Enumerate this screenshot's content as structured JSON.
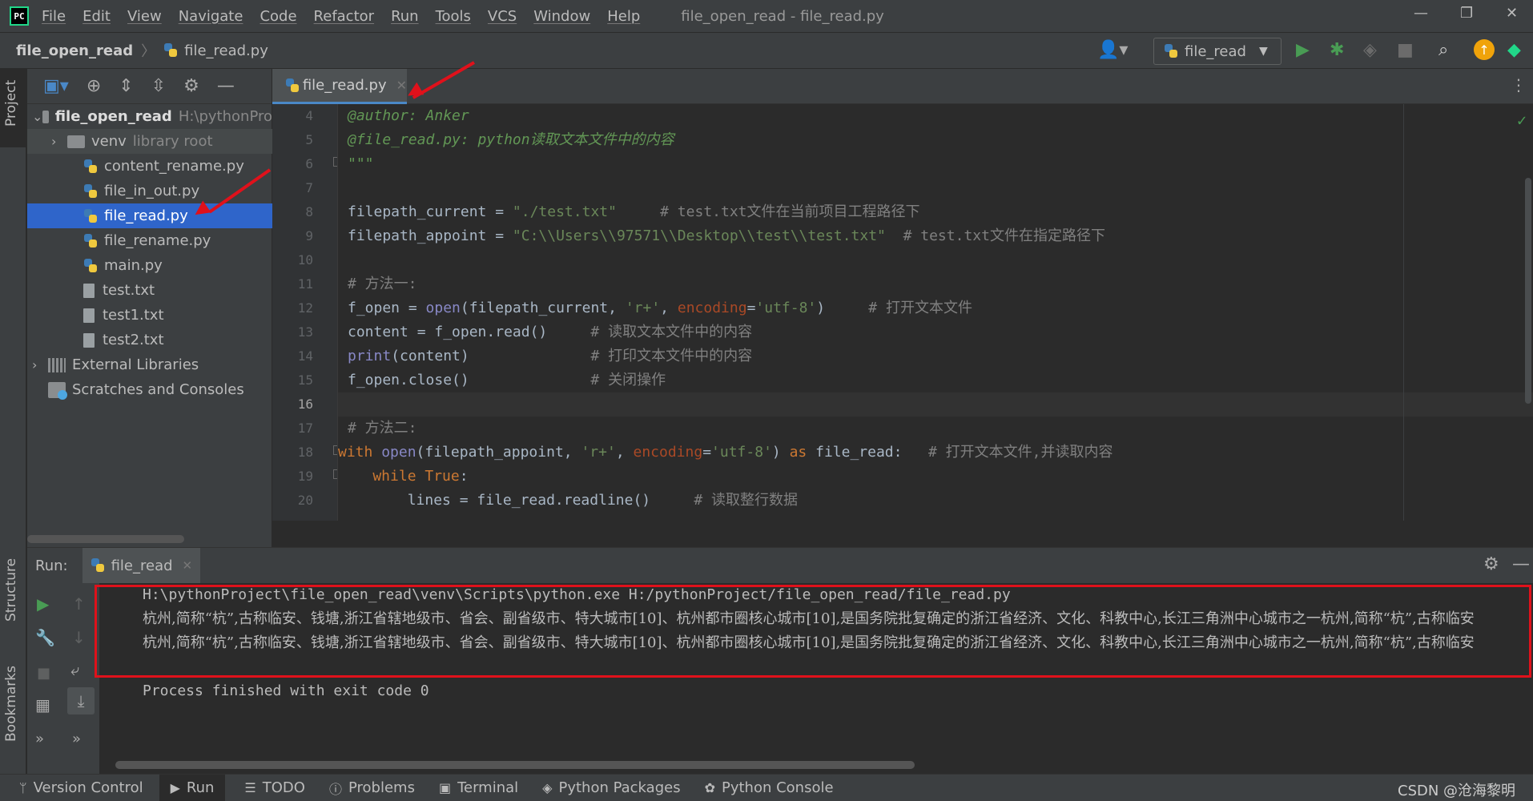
{
  "menubar": {
    "logo": "PC",
    "items": [
      "File",
      "Edit",
      "View",
      "Navigate",
      "Code",
      "Refactor",
      "Run",
      "Tools",
      "VCS",
      "Window",
      "Help"
    ],
    "title": "file_open_read - file_read.py",
    "controls": [
      "—",
      "❐",
      "✕"
    ]
  },
  "navbar": {
    "project": "file_open_read",
    "file": "file_read.py",
    "run_config": "file_read"
  },
  "sidebar_strip": {
    "project": "Project",
    "structure": "Structure",
    "bookmarks": "Bookmarks"
  },
  "project_tree": {
    "root_name": "file_open_read",
    "root_path": "H:\\pythonPro",
    "venv_name": "venv",
    "venv_note": "library root",
    "files": [
      "content_rename.py",
      "file_in_out.py",
      "file_read.py",
      "file_rename.py",
      "main.py",
      "test.txt",
      "test1.txt",
      "test2.txt"
    ],
    "external_libraries": "External Libraries",
    "scratches": "Scratches and Consoles"
  },
  "editor": {
    "tab": "file_read.py",
    "line_numbers": [
      "4",
      "5",
      "6",
      "7",
      "8",
      "9",
      "10",
      "11",
      "12",
      "13",
      "14",
      "15",
      "16",
      "17",
      "18",
      "19",
      "20"
    ],
    "current_line": "16"
  },
  "code": {
    "l4": "@author: Anker",
    "l5": "@file_read.py: python读取文本文件中的内容",
    "l6": "\"\"\"",
    "l8_var": "filepath_current = ",
    "l8_str": "\"./test.txt\"",
    "l8_com": "     # test.txt文件在当前项目工程路径下",
    "l9_var": "filepath_appoint = ",
    "l9_str": "\"C:\\\\Users\\\\97571\\\\Desktop\\\\test\\\\test.txt\"",
    "l9_com": "  # test.txt文件在指定路径下",
    "l11": "# 方法一:",
    "l12_a": "f_open = ",
    "l12_b": "open",
    "l12_c": "(filepath_current, ",
    "l12_d": "'r+'",
    "l12_e": ", ",
    "l12_f": "encoding",
    "l12_g": "=",
    "l12_h": "'utf-8'",
    "l12_i": ")",
    "l12_com": "     # 打开文本文件",
    "l13": "content = f_open.read()",
    "l13_com": "     # 读取文本文件中的内容",
    "l14_a": "print",
    "l14_b": "(content)",
    "l14_com": "              # 打印文本文件中的内容",
    "l15": "f_open.close()",
    "l15_com": "              # 关闭操作",
    "l17": "# 方法二:",
    "l18_a": "with ",
    "l18_b": "open",
    "l18_c": "(filepath_appoint, ",
    "l18_d": "'r+'",
    "l18_e": ", ",
    "l18_f": "encoding",
    "l18_g": "=",
    "l18_h": "'utf-8'",
    "l18_i": ") ",
    "l18_j": "as ",
    "l18_k": "file_read:",
    "l18_com": "   # 打开文本文件,并读取内容",
    "l19_a": "    while ",
    "l19_b": "True",
    "l19_c": ":",
    "l20": "        lines = file_read.readline()",
    "l20_com": "     # 读取整行数据"
  },
  "run": {
    "label": "Run:",
    "tab": "file_read",
    "cmd": "H:\\pythonProject\\file_open_read\\venv\\Scripts\\python.exe H:/pythonProject/file_open_read/file_read.py",
    "out1": "杭州,简称“杭”,古称临安、钱塘,浙江省辖地级市、省会、副省级市、特大城市[10]、杭州都市圈核心城市[10],是国务院批复确定的浙江省经济、文化、科教中心,长江三角洲中心城市之一杭州,简称“杭”,古称临安",
    "out2": "杭州,简称“杭”,古称临安、钱塘,浙江省辖地级市、省会、副省级市、特大城市[10]、杭州都市圈核心城市[10],是国务院批复确定的浙江省经济、文化、科教中心,长江三角洲中心城市之一杭州,简称“杭”,古称临安",
    "finished": "Process finished with exit code 0"
  },
  "statusbar": {
    "items": [
      "Version Control",
      "Run",
      "TODO",
      "Problems",
      "Terminal",
      "Python Packages",
      "Python Console"
    ],
    "watermark": "CSDN @沧海黎明"
  },
  "colors": {
    "accent": "#2f65ca",
    "alert": "#e0111b",
    "run_green": "#499c54"
  }
}
